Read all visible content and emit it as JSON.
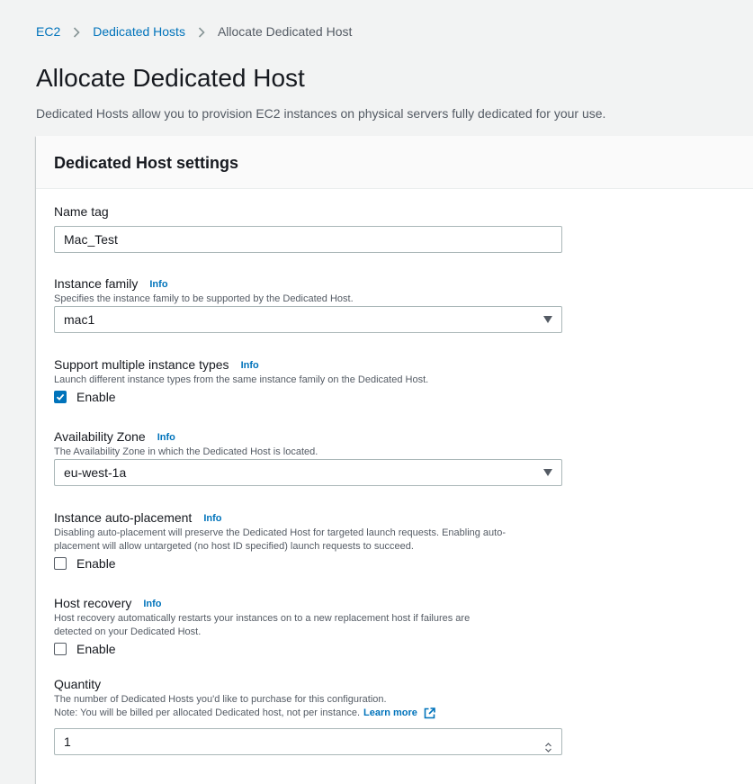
{
  "breadcrumb": {
    "items": [
      {
        "label": "EC2"
      },
      {
        "label": "Dedicated Hosts"
      },
      {
        "label": "Allocate Dedicated Host"
      }
    ]
  },
  "page": {
    "title": "Allocate Dedicated Host",
    "description": "Dedicated Hosts allow you to provision EC2 instances on physical servers fully dedicated for your use."
  },
  "panel": {
    "title": "Dedicated Host settings"
  },
  "info_label": "Info",
  "fields": {
    "name_tag": {
      "label": "Name tag",
      "value": "Mac_Test"
    },
    "instance_family": {
      "label": "Instance family",
      "description": "Specifies the instance family to be supported by the Dedicated Host.",
      "value": "mac1"
    },
    "multiple_types": {
      "label": "Support multiple instance types",
      "description": "Launch different instance types from the same instance family on the Dedicated Host.",
      "checkbox_label": "Enable",
      "checked": true
    },
    "availability_zone": {
      "label": "Availability Zone",
      "description": "The Availability Zone in which the Dedicated Host is located.",
      "value": "eu-west-1a"
    },
    "auto_placement": {
      "label": "Instance auto-placement",
      "description_line1": "Disabling auto-placement will preserve the Dedicated Host for targeted launch requests. Enabling auto-",
      "description_line2": "placement will allow untargeted (no host ID specified) launch requests to succeed.",
      "checkbox_label": "Enable",
      "checked": false
    },
    "host_recovery": {
      "label": "Host recovery",
      "description_line1": "Host recovery automatically restarts your instances on to a new replacement host if failures are",
      "description_line2": "detected on your Dedicated Host.",
      "checkbox_label": "Enable",
      "checked": false
    },
    "quantity": {
      "label": "Quantity",
      "description_line1": "The number of Dedicated Hosts you'd like to purchase for this configuration.",
      "description_line2": "Note: You will be billed per allocated Dedicated host, not per instance.",
      "learn_more": "Learn more",
      "value": "1"
    }
  },
  "colors": {
    "link": "#0073bb",
    "text": "#16191f",
    "muted": "#545b64",
    "border": "#aab7b8",
    "background": "#f2f3f3"
  }
}
